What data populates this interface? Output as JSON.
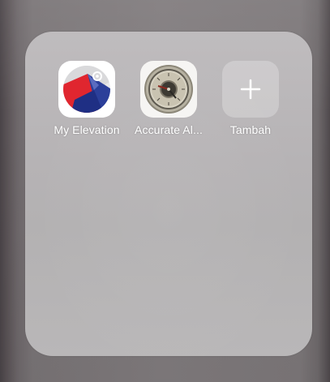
{
  "folder": {
    "apps": [
      {
        "label": "My Elevation",
        "icon": "my-elevation-app-icon"
      },
      {
        "label": "Accurate Al...",
        "icon": "altimeter-gauge-app-icon"
      },
      {
        "label": "Tambah",
        "icon": "plus-icon"
      }
    ]
  },
  "colors": {
    "folder_background": "#b8b6b7",
    "elevation_red": "#e0262f",
    "elevation_blue": "#2b3f9a",
    "gauge_rim": "#6e6a5f",
    "label_text": "#ffffff"
  }
}
